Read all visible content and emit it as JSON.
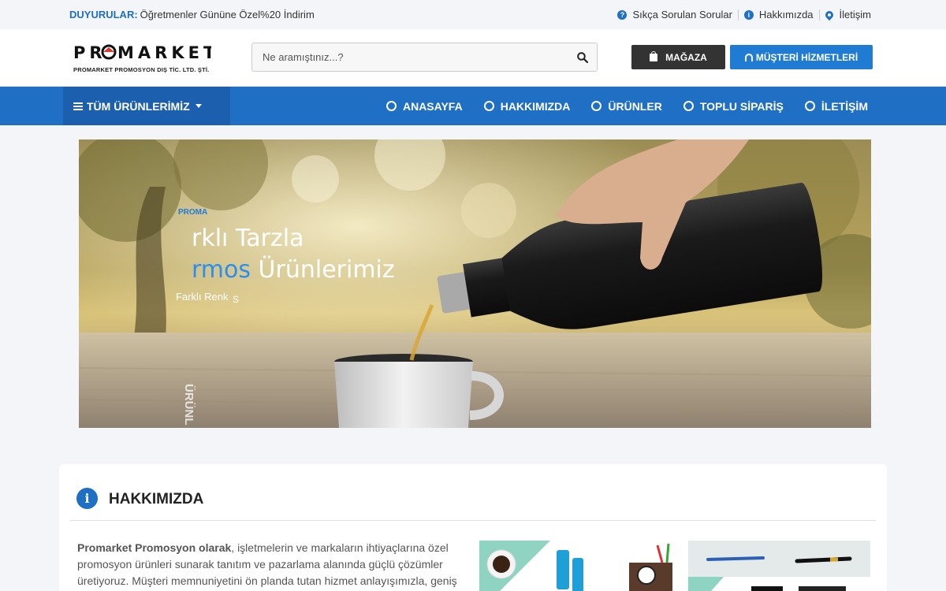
{
  "topbar": {
    "announce_label": "DUYURULAR:",
    "announce_text": "Öğretmenler Gününe Özel%20 İndirim",
    "links": {
      "faq": "Sıkça Sorulan Sorular",
      "about": "Hakkımızda",
      "contact": "İletişim"
    }
  },
  "header": {
    "logo_text": "PROMARKET",
    "logo_sub": "PROMARKET PROMOSYON DIŞ TİC. LTD. ŞTİ.",
    "search_placeholder": "Ne aramıştınız...?",
    "store_button": "MAĞAZA",
    "support_button": "MÜŞTERİ HİZMETLERİ"
  },
  "nav": {
    "all_products": "TÜM ÜRÜNLERİMİZ",
    "items": [
      "ANASAYFA",
      "HAKKIMIZDA",
      "ÜRÜNLER",
      "TOPLU SİPARİŞ",
      "İLETİŞİM"
    ]
  },
  "hero": {
    "small_label": "PROMA",
    "line1": "rklı Tarzla",
    "line2_accent": "rmos",
    "line2_rest": " Ürünlerimiz",
    "sub": "Farklı Renk",
    "sub2": "S",
    "vertical": "ÜRÜNL"
  },
  "about": {
    "title": "HAKKIMIZDA",
    "bold_lead": "Promarket Promosyon olarak",
    "text": ", işletmelerin ve markaların ihtiyaçlarına özel promosyon ürünleri sunarak tanıtım ve pazarlama alanında güçlü çözümler üretiyoruz. Müşteri memnuniyetini ön planda tutan hizmet anlayışımızla, geniş"
  },
  "colors": {
    "brand_blue": "#1f6fc5",
    "dark_button": "#333333",
    "support_button": "#1f7bd3"
  }
}
